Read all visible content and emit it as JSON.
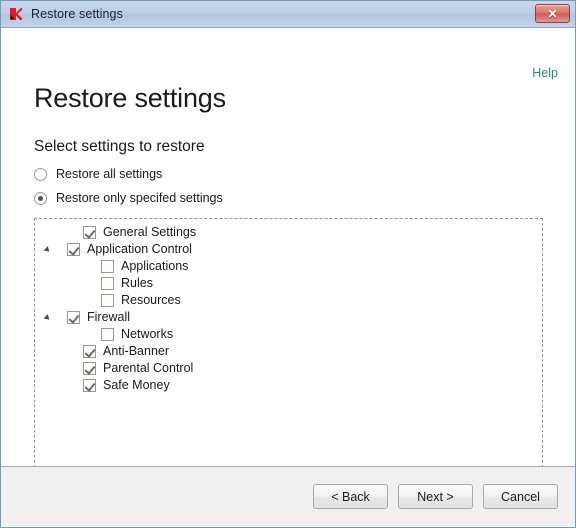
{
  "window": {
    "title": "Restore settings",
    "app_icon": "kaspersky-logo-icon",
    "close_label": "✕"
  },
  "content": {
    "help_label": "Help",
    "page_title": "Restore settings",
    "section_title": "Select settings to restore",
    "radios": [
      {
        "label": "Restore all settings",
        "selected": false
      },
      {
        "label": "Restore only specifed settings",
        "selected": true
      }
    ],
    "tree": [
      {
        "label": "General Settings",
        "checked": true,
        "level": 0,
        "expandable": false
      },
      {
        "label": "Application Control",
        "checked": true,
        "level": 0,
        "expandable": true
      },
      {
        "label": "Applications",
        "checked": false,
        "level": 1,
        "expandable": false
      },
      {
        "label": "Rules",
        "checked": false,
        "level": 1,
        "expandable": false
      },
      {
        "label": "Resources",
        "checked": false,
        "level": 1,
        "expandable": false
      },
      {
        "label": "Firewall",
        "checked": true,
        "level": 0,
        "expandable": true
      },
      {
        "label": "Networks",
        "checked": false,
        "level": 1,
        "expandable": false
      },
      {
        "label": "Anti-Banner",
        "checked": true,
        "level": 0,
        "expandable": false
      },
      {
        "label": "Parental Control",
        "checked": true,
        "level": 0,
        "expandable": false
      },
      {
        "label": "Safe Money",
        "checked": true,
        "level": 0,
        "expandable": false
      }
    ]
  },
  "footer": {
    "buttons": [
      {
        "label": "< Back"
      },
      {
        "label": "Next >"
      },
      {
        "label": "Cancel"
      }
    ]
  },
  "colors": {
    "titlebar": "#bccee5",
    "help_link": "#2a8c7c",
    "close_button": "#d9736c",
    "footer_bg": "#f0f0f0",
    "text": "#1b1b1b"
  }
}
